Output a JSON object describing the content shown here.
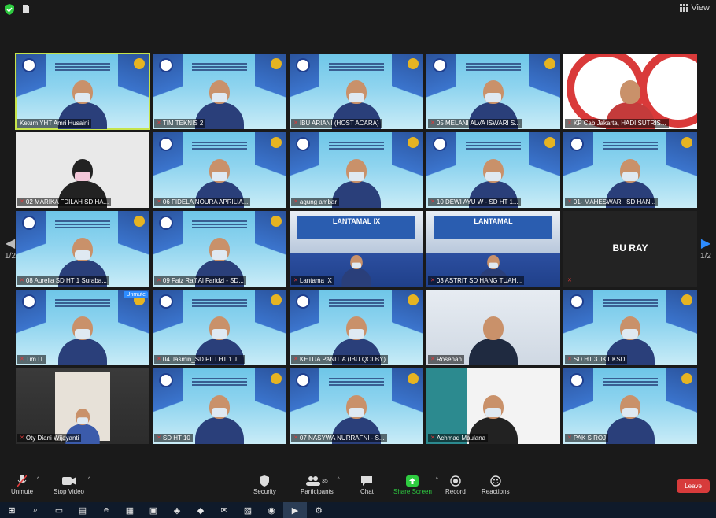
{
  "window": {
    "view_label": "View"
  },
  "pagination": {
    "left": "1/2",
    "right": "1/2"
  },
  "participants": [
    {
      "name": "Ketum YHT Amri Husaini",
      "muted": false,
      "style": "poster",
      "active": true
    },
    {
      "name": "TIM TEKNIS 2",
      "muted": true,
      "style": "poster"
    },
    {
      "name": "IBU ARIANI (HOST ACARA)",
      "muted": true,
      "style": "poster"
    },
    {
      "name": "05 MELANI ALVA ISWARI S...",
      "muted": true,
      "style": "poster"
    },
    {
      "name": "KP Cab Jakarta, HADI SUTRIS...",
      "muted": true,
      "style": "yayasan"
    },
    {
      "name": "02 MARIKA FDILAH SD HA...",
      "muted": true,
      "style": "dark"
    },
    {
      "name": "06 FIDELA NOURA APRILIA...",
      "muted": true,
      "style": "poster"
    },
    {
      "name": "agung ambar",
      "muted": true,
      "style": "poster"
    },
    {
      "name": "10 DEWI AYU W - SD HT 1...",
      "muted": true,
      "style": "poster"
    },
    {
      "name": "01- MAHESWARI_SD HAN...",
      "muted": true,
      "style": "poster"
    },
    {
      "name": "08 Aurelia SD HT 1 Suraba...",
      "muted": true,
      "style": "poster"
    },
    {
      "name": "09 Faiz Raff Al Faridzi - SD...",
      "muted": true,
      "style": "poster"
    },
    {
      "name": "Lantama IX",
      "muted": true,
      "style": "stage",
      "stage_text": "LANTAMAL IX"
    },
    {
      "name": "03 ASTRIT SD HANG TUAH...",
      "muted": true,
      "style": "stage",
      "stage_text": "LANTAMAL"
    },
    {
      "name": "BU RAY",
      "muted": true,
      "style": "blank"
    },
    {
      "name": "Tim IT",
      "muted": true,
      "style": "poster",
      "unmute_tag": "Unmute"
    },
    {
      "name": "04 Jasmin_SD PILI HT 1 J...",
      "muted": true,
      "style": "poster"
    },
    {
      "name": "KETUA PANITIA (IBU QOLBY)",
      "muted": true,
      "style": "poster"
    },
    {
      "name": "Rosenan",
      "muted": true,
      "style": "office"
    },
    {
      "name": "SD HT 3 JKT KSD",
      "muted": true,
      "style": "poster"
    },
    {
      "name": "Oty Diani Wijayanti",
      "muted": true,
      "style": "dark-room"
    },
    {
      "name": "SD HT 10",
      "muted": true,
      "style": "poster"
    },
    {
      "name": "07 NASYWA NURRAFNI - S...",
      "muted": true,
      "style": "poster"
    },
    {
      "name": "Achmad Maulana",
      "muted": true,
      "style": "office2"
    },
    {
      "name": "PAK S ROJ",
      "muted": true,
      "style": "poster"
    }
  ],
  "toolbar": {
    "unmute": "Unmute",
    "stop_video": "Stop Video",
    "security": "Security",
    "participants": "Participants",
    "participants_count": "35",
    "chat": "Chat",
    "share_screen": "Share Screen",
    "record": "Record",
    "reactions": "Reactions",
    "leave": "Leave"
  },
  "colors": {
    "active_speaker": "#c6e44a",
    "leave": "#d73b3b",
    "share": "#2ecc40",
    "accent": "#2d8cff"
  }
}
